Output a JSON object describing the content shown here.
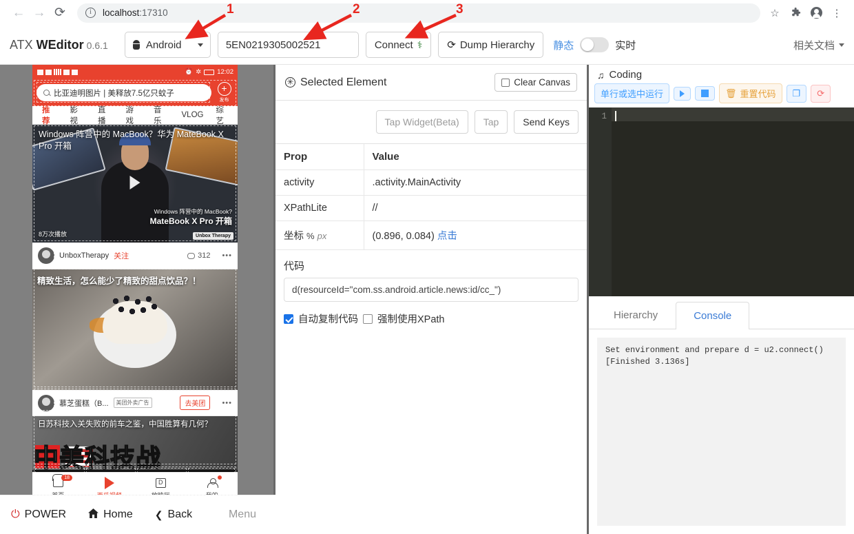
{
  "browser": {
    "back_icon": "←",
    "forward_icon": "→",
    "reload_icon": "⟳",
    "site_info_icon": "ⓘ",
    "url_host": "localhost",
    "url_port": ":17310",
    "star_icon": "☆",
    "extensions_icon": "✦",
    "profile_icon": "account-circle",
    "menu_icon": "⋮"
  },
  "toolbar": {
    "brand_prefix": "ATX ",
    "brand_bold": "WEditor",
    "version": "0.6.1",
    "platform_select": "Android",
    "serial_value": "5EN0219305002521",
    "connect_label": "Connect",
    "connect_icon": "⚕",
    "dump_label": "Dump Hierarchy",
    "dump_icon": "⟳",
    "toggle_left_label": "静态",
    "toggle_right_label": "实时",
    "toggle_on": false,
    "docs_label": "相关文档"
  },
  "annotations": [
    {
      "number": "1"
    },
    {
      "number": "2"
    },
    {
      "number": "3"
    }
  ],
  "device": {
    "status_bar": {
      "time": "12:02"
    },
    "search_text": "比亚迪明图片 | 美释放7.5亿只蚊子",
    "publish_label": "发布",
    "publish_icon": "+",
    "tabs": [
      "推荐",
      "影视",
      "直播",
      "游戏",
      "音乐",
      "VLOG",
      "综艺"
    ],
    "active_tab": "推荐",
    "video_card": {
      "overlay_title": "Windows 阵营中的 MacBook？华为 MateBook X Pro 开箱",
      "watermark_line1": "Windows 阵营中的 MacBook?",
      "watermark_line2": "MateBook X Pro 开箱",
      "plays": "8万次播放",
      "logo": "Unbox Therapy",
      "author": "UnboxTherapy",
      "follow": "关注",
      "comments": "312",
      "more": "•••"
    },
    "food_card": {
      "title": "精致生活，怎么能少了精致的甜点饮品？！",
      "author": "慕芝蛋糕（B...",
      "ad_tag": "美团外卖广告",
      "cta": "去美团",
      "more": "•••"
    },
    "tech_card": {
      "title": "日苏科技入关失败的前车之鉴，中国胜算有几何？",
      "big_text": "中美科技战"
    },
    "nav": [
      {
        "label": "首页",
        "icon": "home-icon",
        "badge": "18",
        "active": false
      },
      {
        "label": "西瓜视频",
        "icon": "play-icon",
        "badge": "",
        "active": true
      },
      {
        "label": "放映厅",
        "icon": "screening-icon",
        "badge": "",
        "active": false
      },
      {
        "label": "我的",
        "icon": "user-icon",
        "badge": "dot",
        "active": false
      }
    ]
  },
  "bottom_bar": {
    "power": "POWER",
    "power_icon": "⏻",
    "home": "Home",
    "home_icon": "⌂",
    "back": "Back",
    "back_icon": "❮",
    "menu": "Menu"
  },
  "selected_element": {
    "panel_title": "Selected Element",
    "panel_icon": "asterisk-icon",
    "clear_canvas": "Clear Canvas",
    "actions": [
      {
        "label": "Tap Widget(Beta)",
        "enabled": false
      },
      {
        "label": "Tap",
        "enabled": false
      },
      {
        "label": "Send Keys",
        "enabled": true
      }
    ],
    "table": {
      "headers": [
        "Prop",
        "Value"
      ],
      "rows": [
        {
          "prop": "activity",
          "value": ".activity.MainActivity",
          "unit": "",
          "link": ""
        },
        {
          "prop": "XPathLite",
          "value": "//",
          "unit": "",
          "link": ""
        },
        {
          "prop": "坐标",
          "unit_pct": "%",
          "unit_px": "px",
          "value": "(0.896, 0.084)",
          "link": "点击"
        }
      ]
    },
    "code_label": "代码",
    "code_value": "d(resourceId=\"com.ss.android.article.news:id/cc_\")",
    "auto_copy_label": "自动复制代码",
    "auto_copy_checked": true,
    "force_xpath_label": "强制使用XPath",
    "force_xpath_checked": false
  },
  "coding": {
    "title": "Coding",
    "title_icon": "♫",
    "tools": [
      {
        "label": "单行或选中运行",
        "style": "blue",
        "icon": ""
      },
      {
        "label": "",
        "style": "blue",
        "icon": "play-icon"
      },
      {
        "label": "",
        "style": "blue",
        "icon": "stop-icon"
      },
      {
        "label": "重置代码",
        "style": "orange",
        "icon": "trash-icon"
      },
      {
        "label": "",
        "style": "blue",
        "icon": "copy-icon"
      },
      {
        "label": "",
        "style": "red",
        "icon": "reload-icon"
      }
    ],
    "editor_line_number": "1",
    "editor_content": ""
  },
  "output": {
    "tabs": [
      {
        "label": "Hierarchy",
        "active": false
      },
      {
        "label": "Console",
        "active": true
      }
    ],
    "console_text": "Set environment and prepare d = u2.connect()\n[Finished 3.136s]"
  }
}
